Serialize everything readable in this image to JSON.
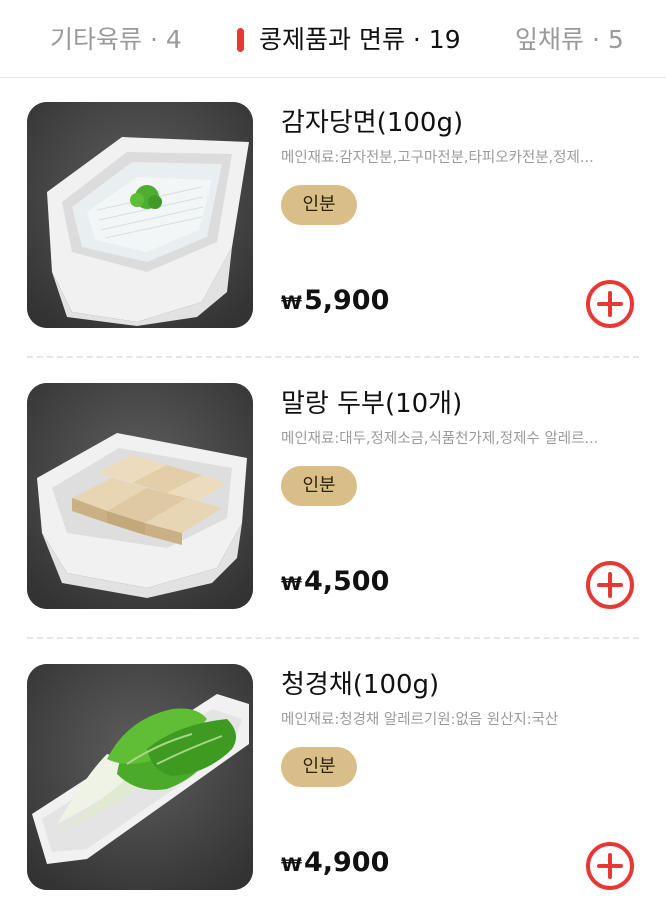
{
  "tabs": [
    {
      "label": "기타육류 · 4",
      "active": false
    },
    {
      "label": "콩제품과 면류 · 19",
      "active": true
    },
    {
      "label": "잎채류 · 5",
      "active": false
    }
  ],
  "currency_symbol": "₩",
  "colors": {
    "accent": "#e53935",
    "badge_bg": "#d9bf87",
    "muted_text": "#9b9b9b"
  },
  "items": [
    {
      "name": "감자당면(100g)",
      "description": "메인재료:감자전분,고구마전분,타피오카전분,정제...",
      "badge": "인분",
      "price": "5,900",
      "image": "glass-noodle-dish-image"
    },
    {
      "name": "말랑 두부(10개)",
      "description": "메인재료:대두,정제소금,식품천가제,정제수 알레르...",
      "badge": "인분",
      "price": "4,500",
      "image": "tofu-dish-image"
    },
    {
      "name": "청경채(100g)",
      "description": "메인재료:청경채 알레르기원:없음 원산지:국산",
      "badge": "인분",
      "price": "4,900",
      "image": "bok-choy-dish-image"
    }
  ]
}
